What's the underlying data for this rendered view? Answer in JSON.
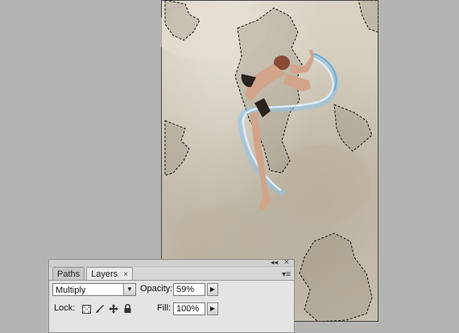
{
  "panel": {
    "tabs": [
      {
        "label": "Paths"
      },
      {
        "label": "Layers",
        "close": "×"
      }
    ],
    "close_glyph": "×",
    "minimize_glyph": "◂◂",
    "menu_glyph": "▾≡"
  },
  "layer_controls": {
    "blend_mode": "Multiply",
    "opacity_label": "Opacity:",
    "opacity_value": "59%",
    "lock_label": "Lock:",
    "fill_label": "Fill:",
    "fill_value": "100%",
    "stepper_glyph": "▶",
    "dropdown_glyph": "▼"
  },
  "icons": {
    "lock_transparency": "checker-square-icon",
    "lock_pixels": "brush-icon",
    "lock_position": "move-icon",
    "lock_all": "padlock-icon"
  }
}
